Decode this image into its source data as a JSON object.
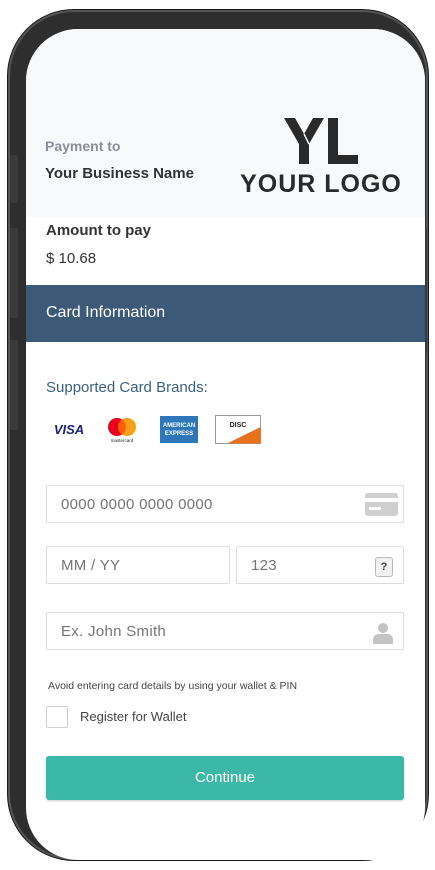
{
  "payment": {
    "payto_label": "Payment to",
    "business_name": "Your Business Name",
    "logo_mark": "YL",
    "logo_text": "YOUR LOGO"
  },
  "amount": {
    "label": "Amount to pay",
    "value": "$ 10.68"
  },
  "card_section": {
    "title": "Card Information",
    "brands_label": "Supported Card Brands:",
    "brands": [
      {
        "name": "visa-icon",
        "text": "VISA"
      },
      {
        "name": "mastercard-icon",
        "text": "mastercard"
      },
      {
        "name": "amex-icon",
        "text": "AMERICAN EXPRESS"
      },
      {
        "name": "discover-icon",
        "text": "DISCOVER"
      }
    ]
  },
  "fields": {
    "card_number_placeholder": "0000 0000 0000 0000",
    "expiry_placeholder": "MM / YY",
    "cvc_placeholder": "123",
    "cvc_help": "?",
    "name_placeholder": "Ex. John Smith"
  },
  "wallet": {
    "note": "Avoid entering card details by using your wallet & PIN",
    "register_label": "Register for Wallet"
  },
  "actions": {
    "continue_label": "Continue"
  },
  "colors": {
    "accent": "#3bb8a8",
    "section_bar": "#3c5a77",
    "brand_label": "#3a6182"
  }
}
